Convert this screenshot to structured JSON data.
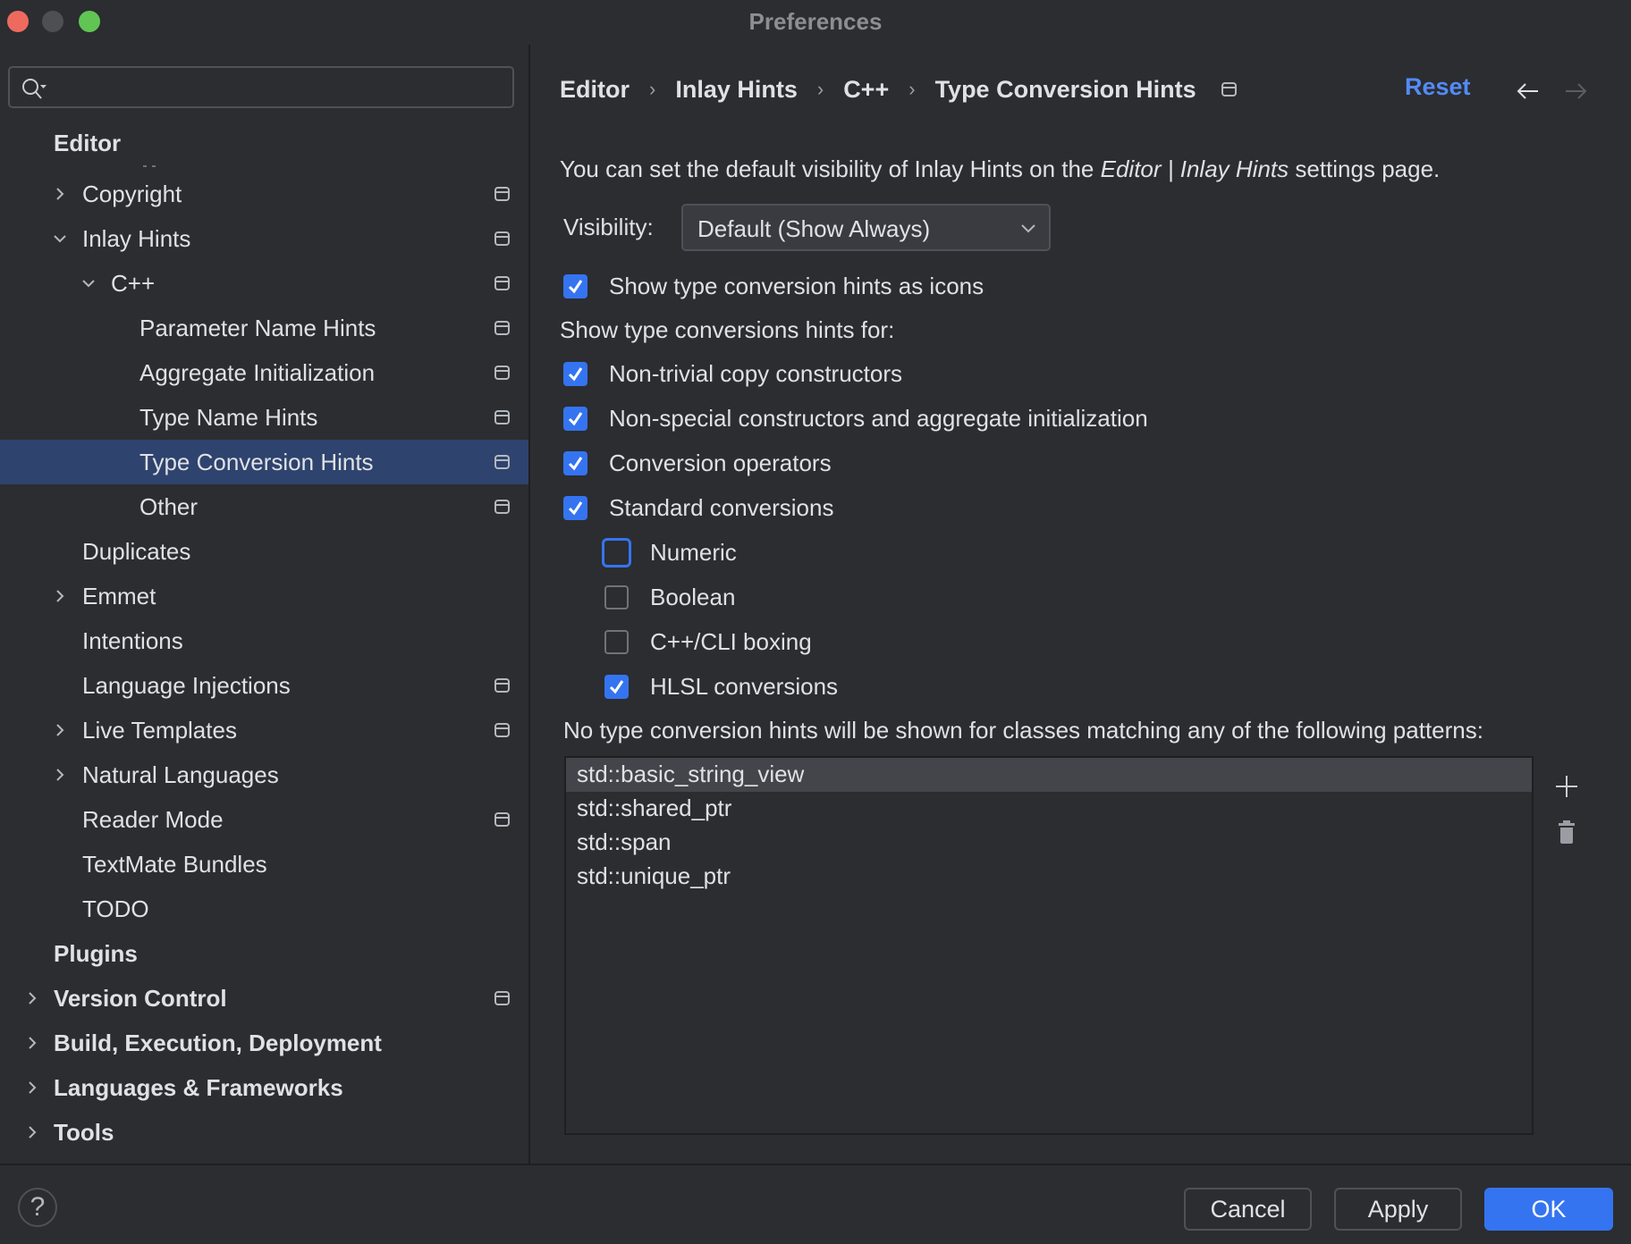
{
  "window": {
    "title": "Preferences"
  },
  "sidebar": {
    "search": {
      "placeholder": "",
      "value": ""
    },
    "items": [
      {
        "label": "Editor",
        "level": 0,
        "bold": true,
        "expander": "none",
        "project_icon": false,
        "selected": false
      },
      {
        "label": "Copyright",
        "level": 1,
        "bold": false,
        "expander": "collapsed",
        "project_icon": true,
        "selected": false
      },
      {
        "label": "Inlay Hints",
        "level": 1,
        "bold": false,
        "expander": "expanded",
        "project_icon": true,
        "selected": false
      },
      {
        "label": "C++",
        "level": 2,
        "bold": false,
        "expander": "expanded",
        "project_icon": true,
        "selected": false
      },
      {
        "label": "Parameter Name Hints",
        "level": 3,
        "bold": false,
        "expander": "none",
        "project_icon": true,
        "selected": false
      },
      {
        "label": "Aggregate Initialization",
        "level": 3,
        "bold": false,
        "expander": "none",
        "project_icon": true,
        "selected": false
      },
      {
        "label": "Type Name Hints",
        "level": 3,
        "bold": false,
        "expander": "none",
        "project_icon": true,
        "selected": false
      },
      {
        "label": "Type Conversion Hints",
        "level": 3,
        "bold": false,
        "expander": "none",
        "project_icon": true,
        "selected": true
      },
      {
        "label": "Other",
        "level": 3,
        "bold": false,
        "expander": "none",
        "project_icon": true,
        "selected": false
      },
      {
        "label": "Duplicates",
        "level": 1,
        "bold": false,
        "expander": "none",
        "project_icon": false,
        "selected": false
      },
      {
        "label": "Emmet",
        "level": 1,
        "bold": false,
        "expander": "collapsed",
        "project_icon": false,
        "selected": false
      },
      {
        "label": "Intentions",
        "level": 1,
        "bold": false,
        "expander": "none",
        "project_icon": false,
        "selected": false
      },
      {
        "label": "Language Injections",
        "level": 1,
        "bold": false,
        "expander": "none",
        "project_icon": true,
        "selected": false
      },
      {
        "label": "Live Templates",
        "level": 1,
        "bold": false,
        "expander": "collapsed",
        "project_icon": true,
        "selected": false
      },
      {
        "label": "Natural Languages",
        "level": 1,
        "bold": false,
        "expander": "collapsed",
        "project_icon": false,
        "selected": false
      },
      {
        "label": "Reader Mode",
        "level": 1,
        "bold": false,
        "expander": "none",
        "project_icon": true,
        "selected": false
      },
      {
        "label": "TextMate Bundles",
        "level": 1,
        "bold": false,
        "expander": "none",
        "project_icon": false,
        "selected": false
      },
      {
        "label": "TODO",
        "level": 1,
        "bold": false,
        "expander": "none",
        "project_icon": false,
        "selected": false
      },
      {
        "label": "Plugins",
        "level": 0,
        "bold": true,
        "expander": "none",
        "project_icon": false,
        "selected": false
      },
      {
        "label": "Version Control",
        "level": 0,
        "bold": true,
        "expander": "collapsed",
        "project_icon": true,
        "selected": false
      },
      {
        "label": "Build, Execution, Deployment",
        "level": 0,
        "bold": true,
        "expander": "collapsed",
        "project_icon": false,
        "selected": false
      },
      {
        "label": "Languages & Frameworks",
        "level": 0,
        "bold": true,
        "expander": "collapsed",
        "project_icon": false,
        "selected": false
      },
      {
        "label": "Tools",
        "level": 0,
        "bold": true,
        "expander": "collapsed",
        "project_icon": false,
        "selected": false
      }
    ]
  },
  "header": {
    "breadcrumb": [
      "Editor",
      "Inlay Hints",
      "C++",
      "Type Conversion Hints"
    ],
    "reset_label": "Reset",
    "back_icon": "arrow-left-icon",
    "forward_icon": "arrow-right-icon"
  },
  "content": {
    "info_prefix": "You can set the default visibility of Inlay Hints on the ",
    "info_link": "Editor | Inlay Hints",
    "info_suffix": " settings page.",
    "visibility_label": "Visibility:",
    "visibility_value": "Default (Show Always)",
    "show_as_icons": {
      "label": "Show type conversion hints as icons",
      "checked": true
    },
    "hints_for_label": "Show type conversions hints for:",
    "options": [
      {
        "label": "Non-trivial copy constructors",
        "checked": true,
        "indent": 0,
        "focused": false
      },
      {
        "label": "Non-special constructors and aggregate initialization",
        "checked": true,
        "indent": 0,
        "focused": false
      },
      {
        "label": "Conversion operators",
        "checked": true,
        "indent": 0,
        "focused": false
      },
      {
        "label": "Standard conversions",
        "checked": true,
        "indent": 0,
        "focused": false
      },
      {
        "label": "Numeric",
        "checked": false,
        "indent": 1,
        "focused": true
      },
      {
        "label": "Boolean",
        "checked": false,
        "indent": 1,
        "focused": false
      },
      {
        "label": "C++/CLI boxing",
        "checked": false,
        "indent": 1,
        "focused": false
      },
      {
        "label": "HLSL conversions",
        "checked": true,
        "indent": 1,
        "focused": false
      }
    ],
    "patterns_label": "No type conversion hints will be shown for classes matching any of the following patterns:",
    "patterns": [
      {
        "value": "std::basic_string_view",
        "selected": true
      },
      {
        "value": "std::shared_ptr",
        "selected": false
      },
      {
        "value": "std::span",
        "selected": false
      },
      {
        "value": "std::unique_ptr",
        "selected": false
      }
    ]
  },
  "footer": {
    "help_label": "?",
    "cancel_label": "Cancel",
    "apply_label": "Apply",
    "ok_label": "OK"
  },
  "colors": {
    "accent": "#3574f0",
    "link": "#548af7",
    "selection": "#2e436e",
    "background": "#2b2d30"
  }
}
